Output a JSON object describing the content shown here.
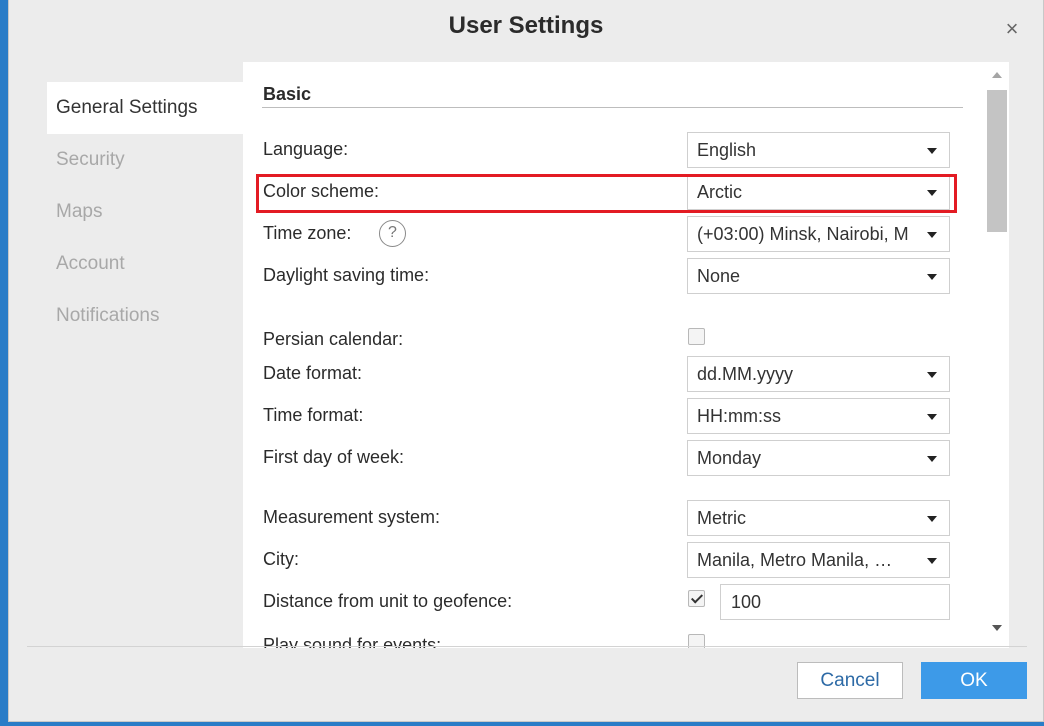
{
  "dialog": {
    "title": "User Settings",
    "close_glyph": "×"
  },
  "sidebar": {
    "items": [
      {
        "label": "General Settings",
        "active": true
      },
      {
        "label": "Security",
        "active": false
      },
      {
        "label": "Maps",
        "active": false
      },
      {
        "label": "Account",
        "active": false
      },
      {
        "label": "Notifications",
        "active": false
      }
    ]
  },
  "section": {
    "title": "Basic"
  },
  "fields": {
    "language": {
      "label": "Language:",
      "value": "English"
    },
    "color_scheme": {
      "label": "Color scheme:",
      "value": "Arctic"
    },
    "time_zone": {
      "label": "Time zone:",
      "help_glyph": "?",
      "value": "(+03:00) Minsk, Nairobi, M"
    },
    "daylight_saving": {
      "label": "Daylight saving time:",
      "value": "None"
    },
    "persian_calendar": {
      "label": "Persian calendar:",
      "checked": false
    },
    "date_format": {
      "label": "Date format:",
      "value": "dd.MM.yyyy"
    },
    "time_format": {
      "label": "Time format:",
      "value": "HH:mm:ss"
    },
    "first_day": {
      "label": "First day of week:",
      "value": "Monday"
    },
    "measurement": {
      "label": "Measurement system:",
      "value": "Metric"
    },
    "city": {
      "label": "City:",
      "value": "Manila, Metro Manila, …"
    },
    "geofence_distance": {
      "label": "Distance from unit to geofence:",
      "checked": true,
      "value": "100"
    },
    "play_sound": {
      "label": "Play sound for events:",
      "checked": false
    }
  },
  "buttons": {
    "cancel": "Cancel",
    "ok": "OK"
  },
  "colors": {
    "highlight": "#e31b23",
    "primary": "#3d9ae8",
    "backdrop": "#2a7cc7"
  }
}
